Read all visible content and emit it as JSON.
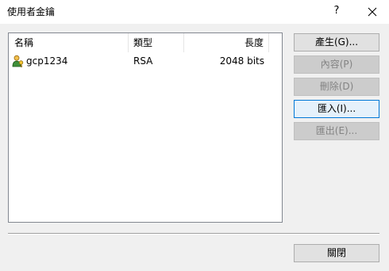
{
  "dialog": {
    "title": "使用者金鑰",
    "help_label": "?"
  },
  "keys_list": {
    "columns": [
      "名稱",
      "類型",
      "長度"
    ],
    "rows": [
      {
        "name": "gcp1234",
        "type": "RSA",
        "length": "2048 bits",
        "icon": "user-key-icon"
      }
    ]
  },
  "buttons": {
    "generate": "產生(G)...",
    "properties": "內容(P)",
    "delete": "刪除(D)",
    "import": "匯入(I)...",
    "export": "匯出(E)...",
    "close": "關閉"
  },
  "icons": {
    "close": "close-icon",
    "key": "user-key-icon"
  },
  "colors": {
    "focus_border": "#0078d7",
    "disabled_text": "#838383"
  }
}
